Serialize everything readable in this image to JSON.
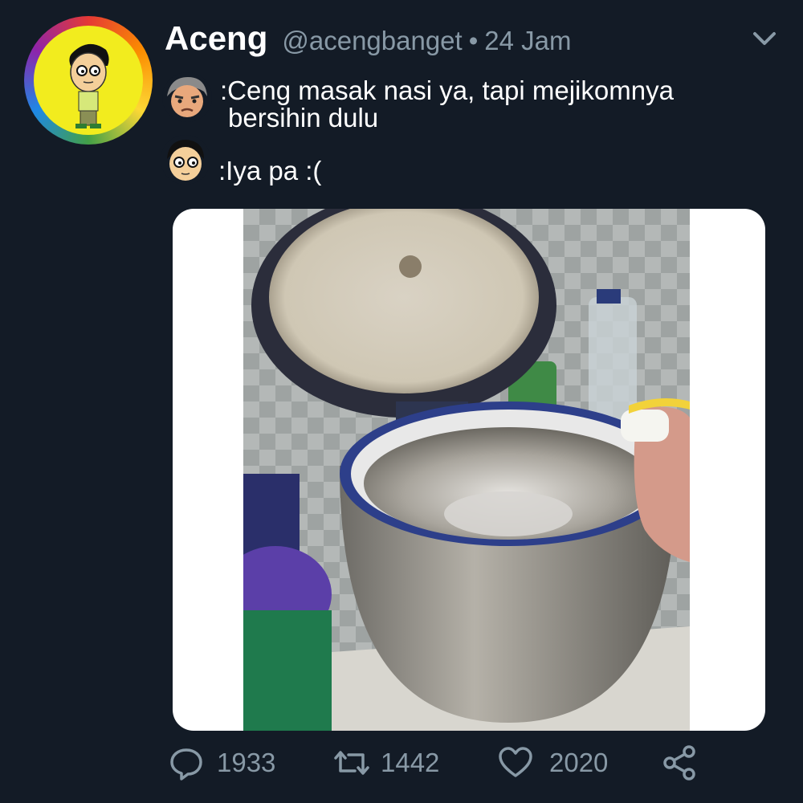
{
  "tweet": {
    "author_name": "Aceng",
    "handle": "@acengbanget",
    "separator": "•",
    "timestamp": "24 Jam",
    "lines": [
      {
        "speaker_icon": "father-avatar-icon",
        "text_line1": ":Ceng masak nasi ya, tapi mejikomnya",
        "text_line2": "bersihin dulu"
      },
      {
        "speaker_icon": "aceng-avatar-icon",
        "text_line1": ":Iya pa :("
      }
    ],
    "photo": {
      "description_icon": "rice-cooker-photo"
    }
  },
  "actions": {
    "reply_count": "1933",
    "retweet_count": "1442",
    "like_count": "2020"
  },
  "colors": {
    "background": "#131b26",
    "muted": "#8899a6",
    "text": "#ffffff"
  }
}
